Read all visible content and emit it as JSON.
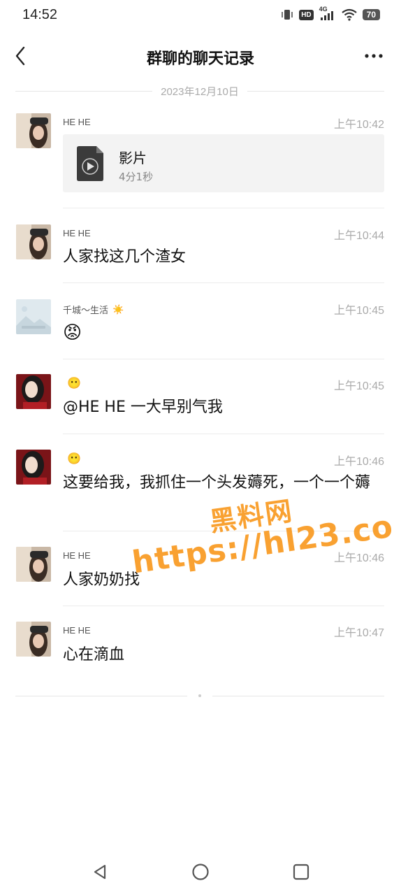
{
  "status_bar": {
    "time": "14:52",
    "hd": "HD",
    "network": "4G",
    "battery": "70"
  },
  "header": {
    "title": "群聊的聊天记录",
    "back_icon": "chevron-left-icon",
    "more_icon": "more-horizontal-icon"
  },
  "date_divider": "2023年12月10日",
  "messages": [
    {
      "sender": "HE HE",
      "time": "上午10:42",
      "type": "video",
      "video": {
        "name": "影片",
        "duration": "4分1秒"
      }
    },
    {
      "sender": "HE HE",
      "time": "上午10:44",
      "text": "人家找这几个渣女"
    },
    {
      "sender": "千城～生活",
      "sender_emoji": "☀️",
      "time": "上午10:45",
      "emoji": "😡"
    },
    {
      "sender": "",
      "sender_emoji": "😶",
      "time": "上午10:45",
      "text": "@HE HE 一大早别气我"
    },
    {
      "sender": "",
      "sender_emoji": "😶",
      "time": "上午10:46",
      "text": "这要给我，我抓住一个头发薅死，一个一个薅"
    },
    {
      "sender": "HE HE",
      "time": "上午10:46",
      "text": "人家奶奶找"
    },
    {
      "sender": "HE HE",
      "time": "上午10:47",
      "text": "心在滴血"
    }
  ],
  "watermark": {
    "title": "黑料网",
    "url": "https://hl23.co"
  },
  "colors": {
    "watermark": "#F89414",
    "time_text": "#AAAAAA",
    "card_bg": "#F3F3F3"
  }
}
